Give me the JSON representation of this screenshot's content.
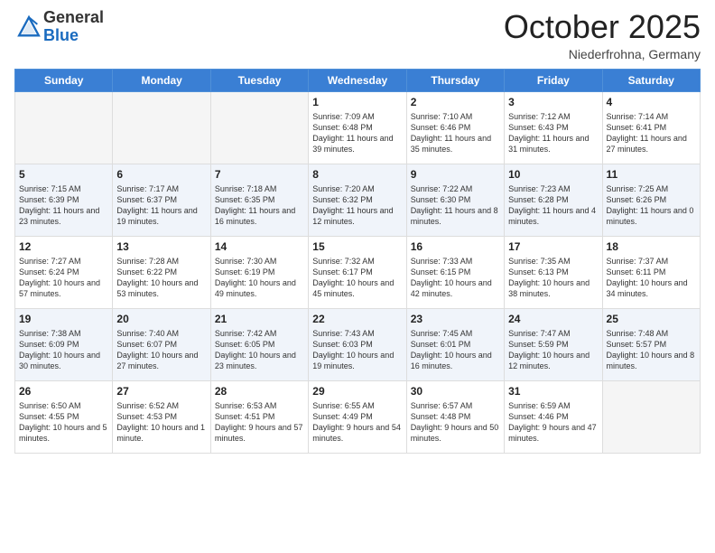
{
  "header": {
    "logo_general": "General",
    "logo_blue": "Blue",
    "month": "October 2025",
    "location": "Niederfrohna, Germany"
  },
  "days_of_week": [
    "Sunday",
    "Monday",
    "Tuesday",
    "Wednesday",
    "Thursday",
    "Friday",
    "Saturday"
  ],
  "weeks": [
    {
      "cells": [
        {
          "day": null
        },
        {
          "day": null
        },
        {
          "day": null
        },
        {
          "day": "1",
          "sunrise": "7:09 AM",
          "sunset": "6:48 PM",
          "daylight": "11 hours and 39 minutes."
        },
        {
          "day": "2",
          "sunrise": "7:10 AM",
          "sunset": "6:46 PM",
          "daylight": "11 hours and 35 minutes."
        },
        {
          "day": "3",
          "sunrise": "7:12 AM",
          "sunset": "6:43 PM",
          "daylight": "11 hours and 31 minutes."
        },
        {
          "day": "4",
          "sunrise": "7:14 AM",
          "sunset": "6:41 PM",
          "daylight": "11 hours and 27 minutes."
        }
      ]
    },
    {
      "cells": [
        {
          "day": "5",
          "sunrise": "7:15 AM",
          "sunset": "6:39 PM",
          "daylight": "11 hours and 23 minutes."
        },
        {
          "day": "6",
          "sunrise": "7:17 AM",
          "sunset": "6:37 PM",
          "daylight": "11 hours and 19 minutes."
        },
        {
          "day": "7",
          "sunrise": "7:18 AM",
          "sunset": "6:35 PM",
          "daylight": "11 hours and 16 minutes."
        },
        {
          "day": "8",
          "sunrise": "7:20 AM",
          "sunset": "6:32 PM",
          "daylight": "11 hours and 12 minutes."
        },
        {
          "day": "9",
          "sunrise": "7:22 AM",
          "sunset": "6:30 PM",
          "daylight": "11 hours and 8 minutes."
        },
        {
          "day": "10",
          "sunrise": "7:23 AM",
          "sunset": "6:28 PM",
          "daylight": "11 hours and 4 minutes."
        },
        {
          "day": "11",
          "sunrise": "7:25 AM",
          "sunset": "6:26 PM",
          "daylight": "11 hours and 0 minutes."
        }
      ]
    },
    {
      "cells": [
        {
          "day": "12",
          "sunrise": "7:27 AM",
          "sunset": "6:24 PM",
          "daylight": "10 hours and 57 minutes."
        },
        {
          "day": "13",
          "sunrise": "7:28 AM",
          "sunset": "6:22 PM",
          "daylight": "10 hours and 53 minutes."
        },
        {
          "day": "14",
          "sunrise": "7:30 AM",
          "sunset": "6:19 PM",
          "daylight": "10 hours and 49 minutes."
        },
        {
          "day": "15",
          "sunrise": "7:32 AM",
          "sunset": "6:17 PM",
          "daylight": "10 hours and 45 minutes."
        },
        {
          "day": "16",
          "sunrise": "7:33 AM",
          "sunset": "6:15 PM",
          "daylight": "10 hours and 42 minutes."
        },
        {
          "day": "17",
          "sunrise": "7:35 AM",
          "sunset": "6:13 PM",
          "daylight": "10 hours and 38 minutes."
        },
        {
          "day": "18",
          "sunrise": "7:37 AM",
          "sunset": "6:11 PM",
          "daylight": "10 hours and 34 minutes."
        }
      ]
    },
    {
      "cells": [
        {
          "day": "19",
          "sunrise": "7:38 AM",
          "sunset": "6:09 PM",
          "daylight": "10 hours and 30 minutes."
        },
        {
          "day": "20",
          "sunrise": "7:40 AM",
          "sunset": "6:07 PM",
          "daylight": "10 hours and 27 minutes."
        },
        {
          "day": "21",
          "sunrise": "7:42 AM",
          "sunset": "6:05 PM",
          "daylight": "10 hours and 23 minutes."
        },
        {
          "day": "22",
          "sunrise": "7:43 AM",
          "sunset": "6:03 PM",
          "daylight": "10 hours and 19 minutes."
        },
        {
          "day": "23",
          "sunrise": "7:45 AM",
          "sunset": "6:01 PM",
          "daylight": "10 hours and 16 minutes."
        },
        {
          "day": "24",
          "sunrise": "7:47 AM",
          "sunset": "5:59 PM",
          "daylight": "10 hours and 12 minutes."
        },
        {
          "day": "25",
          "sunrise": "7:48 AM",
          "sunset": "5:57 PM",
          "daylight": "10 hours and 8 minutes."
        }
      ]
    },
    {
      "cells": [
        {
          "day": "26",
          "sunrise": "6:50 AM",
          "sunset": "4:55 PM",
          "daylight": "10 hours and 5 minutes."
        },
        {
          "day": "27",
          "sunrise": "6:52 AM",
          "sunset": "4:53 PM",
          "daylight": "10 hours and 1 minute."
        },
        {
          "day": "28",
          "sunrise": "6:53 AM",
          "sunset": "4:51 PM",
          "daylight": "9 hours and 57 minutes."
        },
        {
          "day": "29",
          "sunrise": "6:55 AM",
          "sunset": "4:49 PM",
          "daylight": "9 hours and 54 minutes."
        },
        {
          "day": "30",
          "sunrise": "6:57 AM",
          "sunset": "4:48 PM",
          "daylight": "9 hours and 50 minutes."
        },
        {
          "day": "31",
          "sunrise": "6:59 AM",
          "sunset": "4:46 PM",
          "daylight": "9 hours and 47 minutes."
        },
        {
          "day": null
        }
      ]
    }
  ]
}
